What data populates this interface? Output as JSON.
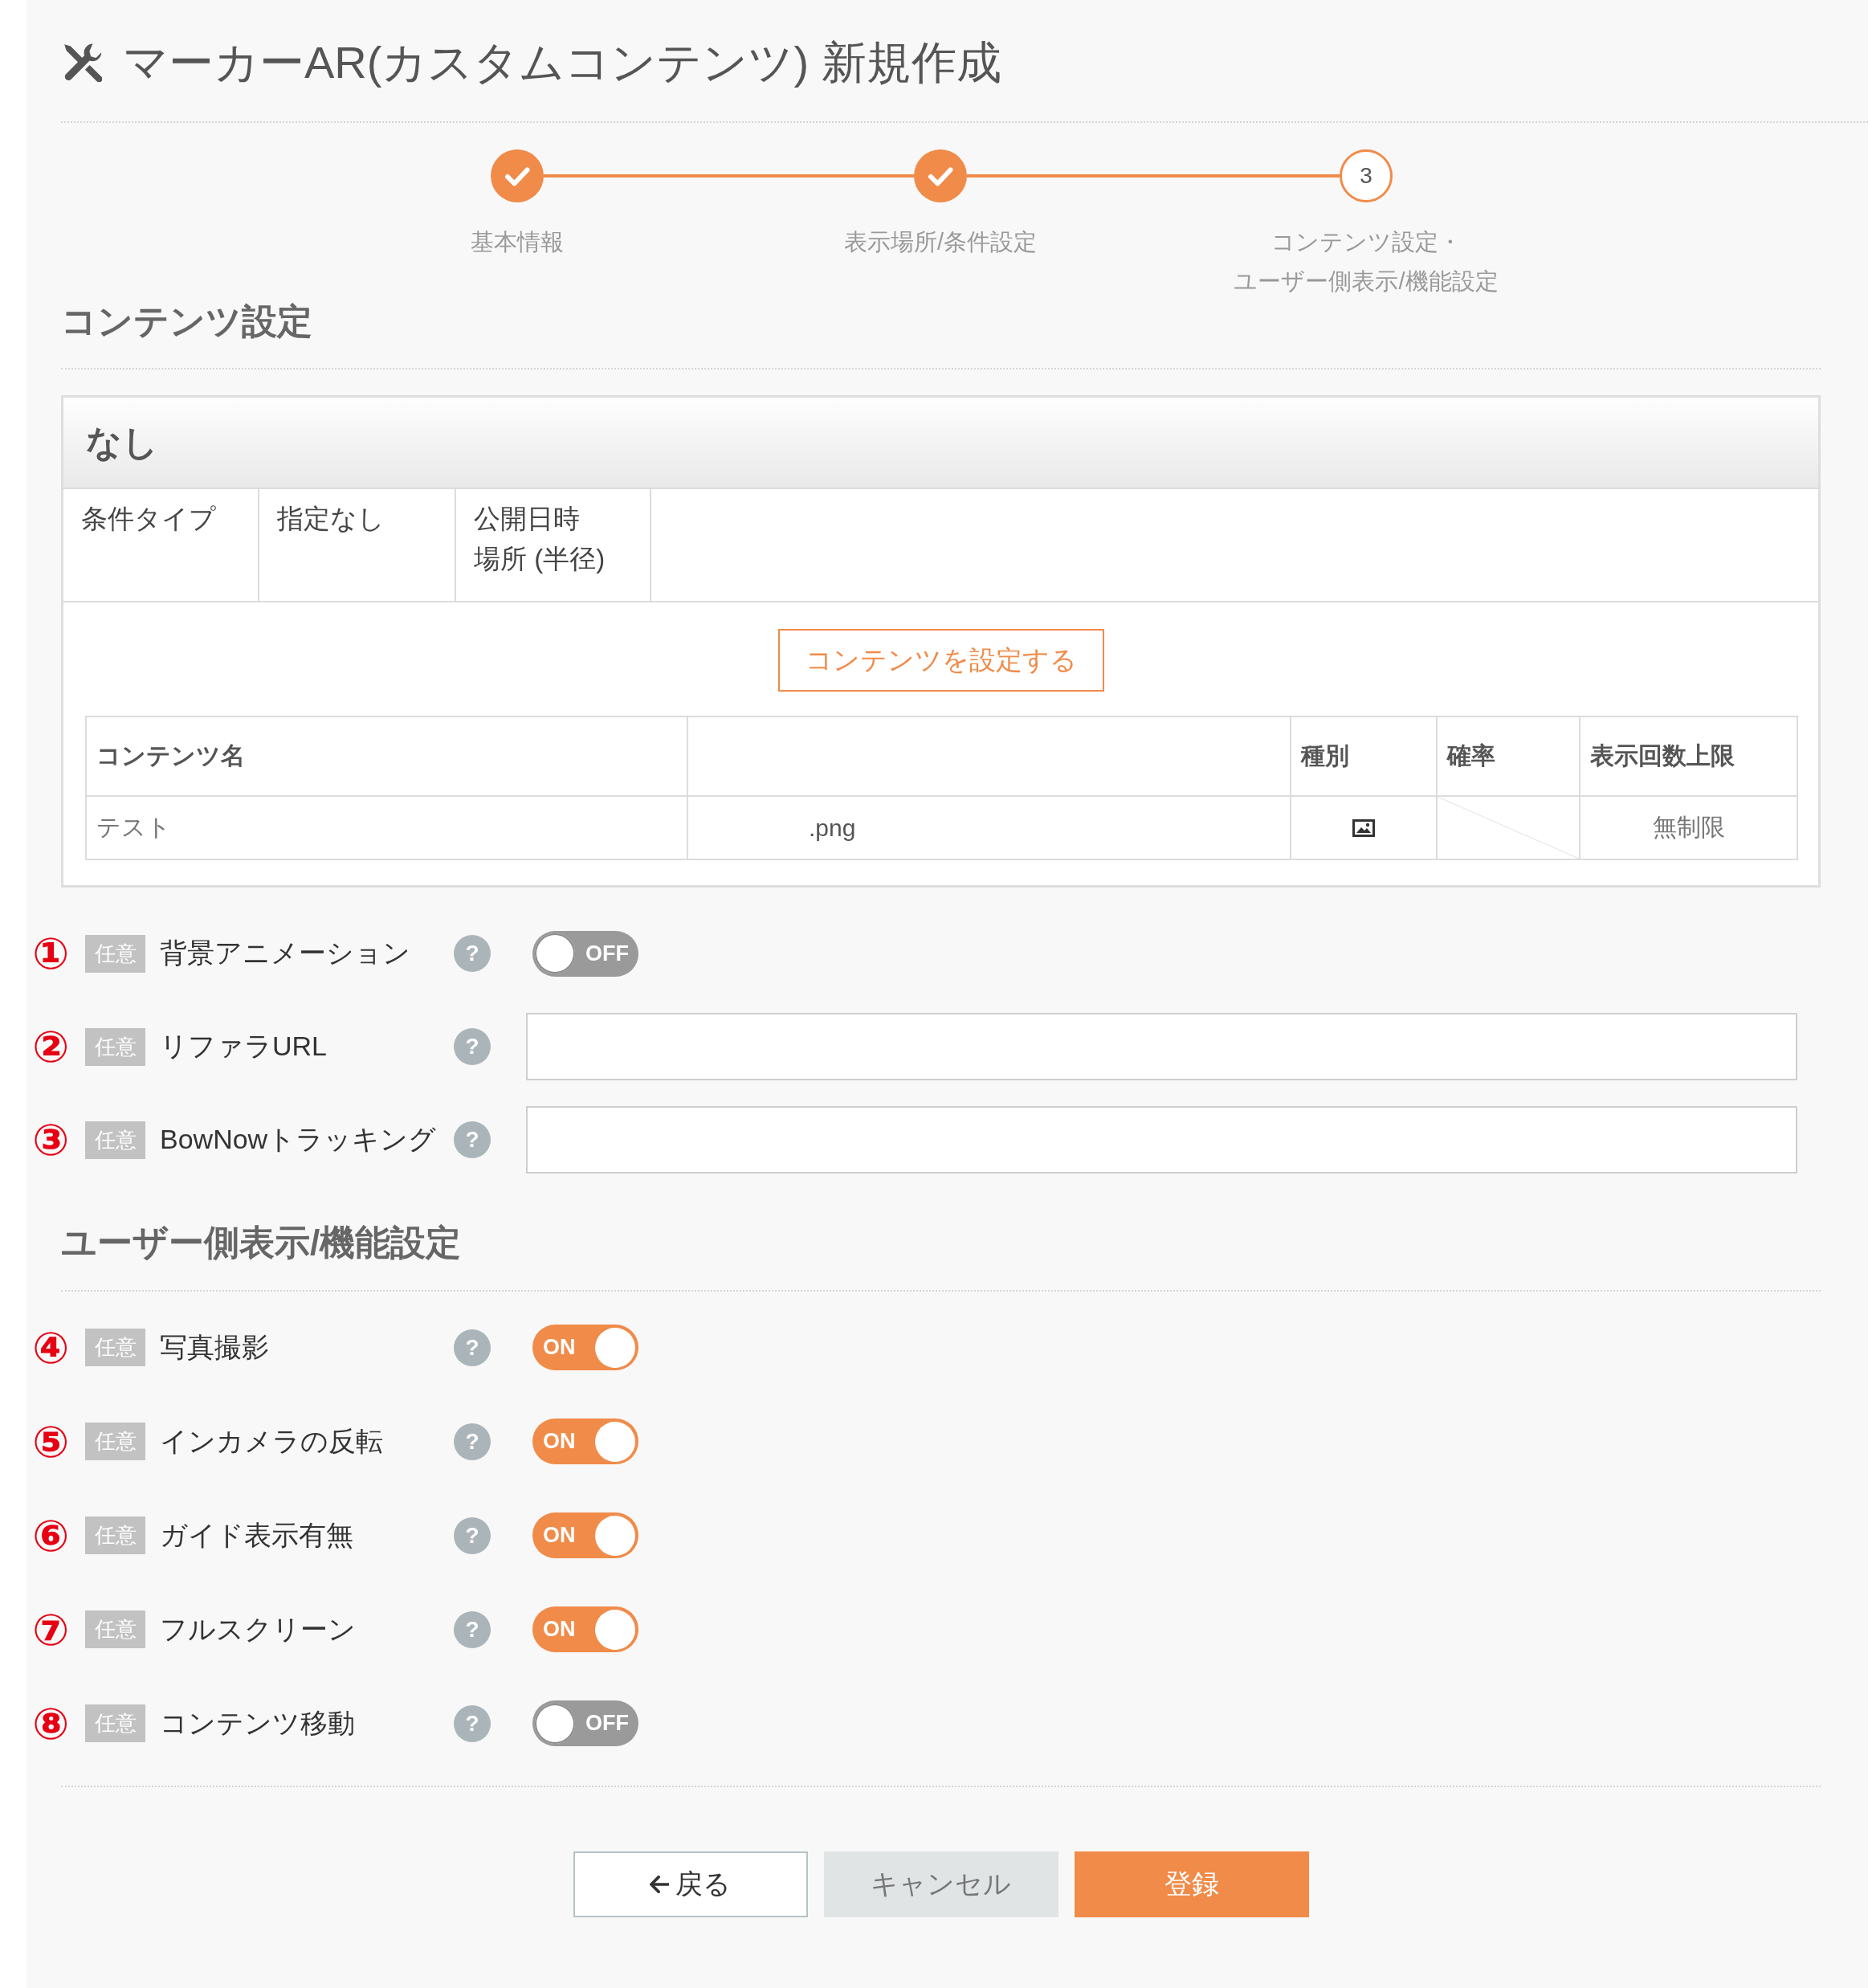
{
  "page": {
    "title": "マーカーAR(カスタムコンテンツ) 新規作成"
  },
  "steps": [
    {
      "label_lines": [
        "基本情報"
      ],
      "done": true
    },
    {
      "label_lines": [
        "表示場所/条件設定"
      ],
      "done": true
    },
    {
      "number": "3",
      "label_lines": [
        "コンテンツ設定・",
        "ユーザー側表示/機能設定"
      ],
      "done": false
    }
  ],
  "content_section": {
    "heading": "コンテンツ設定",
    "panel": {
      "title": "なし",
      "conditions": [
        {
          "lines": [
            "条件タイプ"
          ]
        },
        {
          "lines": [
            "指定なし"
          ]
        },
        {
          "lines": [
            "公開日時",
            "場所 (半径)"
          ]
        }
      ],
      "set_button": "コンテンツを設定する",
      "table": {
        "columns": [
          "コンテンツ名",
          null,
          "種別",
          "確率",
          "表示回数上限"
        ],
        "rows": [
          [
            {
              "kind": "text",
              "text": "テスト"
            },
            {
              "kind": "file",
              "text": ".png"
            },
            {
              "kind": "image"
            },
            {
              "kind": "none"
            },
            {
              "kind": "count",
              "text": "無制限"
            }
          ]
        ]
      }
    },
    "settings": [
      {
        "number": "①",
        "badge": "任意",
        "label": "背景アニメーション",
        "help": "?",
        "kind": "toggle",
        "on": false,
        "toggle_text": "OFF"
      },
      {
        "number": "②",
        "badge": "任意",
        "label": "リファラURL",
        "help": "?",
        "kind": "input"
      },
      {
        "number": "③",
        "badge": "任意",
        "label": "BowNowトラッキング",
        "help": "?",
        "kind": "input"
      }
    ]
  },
  "user_section": {
    "heading": "ユーザー側表示/機能設定",
    "settings": [
      {
        "number": "④",
        "badge": "任意",
        "label": "写真撮影",
        "help": "?",
        "kind": "toggle",
        "on": true,
        "toggle_text": "ON"
      },
      {
        "number": "⑤",
        "badge": "任意",
        "label": "インカメラの反転",
        "help": "?",
        "kind": "toggle",
        "on": true,
        "toggle_text": "ON"
      },
      {
        "number": "⑥",
        "badge": "任意",
        "label": "ガイド表示有無",
        "help": "?",
        "kind": "toggle",
        "on": true,
        "toggle_text": "ON"
      },
      {
        "number": "⑦",
        "badge": "任意",
        "label": "フルスクリーン",
        "help": "?",
        "kind": "toggle",
        "on": true,
        "toggle_text": "ON"
      },
      {
        "number": "⑧",
        "badge": "任意",
        "label": "コンテンツ移動",
        "help": "?",
        "kind": "toggle",
        "on": false,
        "toggle_text": "OFF"
      }
    ]
  },
  "buttons": [
    {
      "kind": "back",
      "label": "戻る"
    },
    {
      "kind": "cancel",
      "label": "キャンセル"
    },
    {
      "kind": "submit",
      "label": "登録"
    }
  ]
}
